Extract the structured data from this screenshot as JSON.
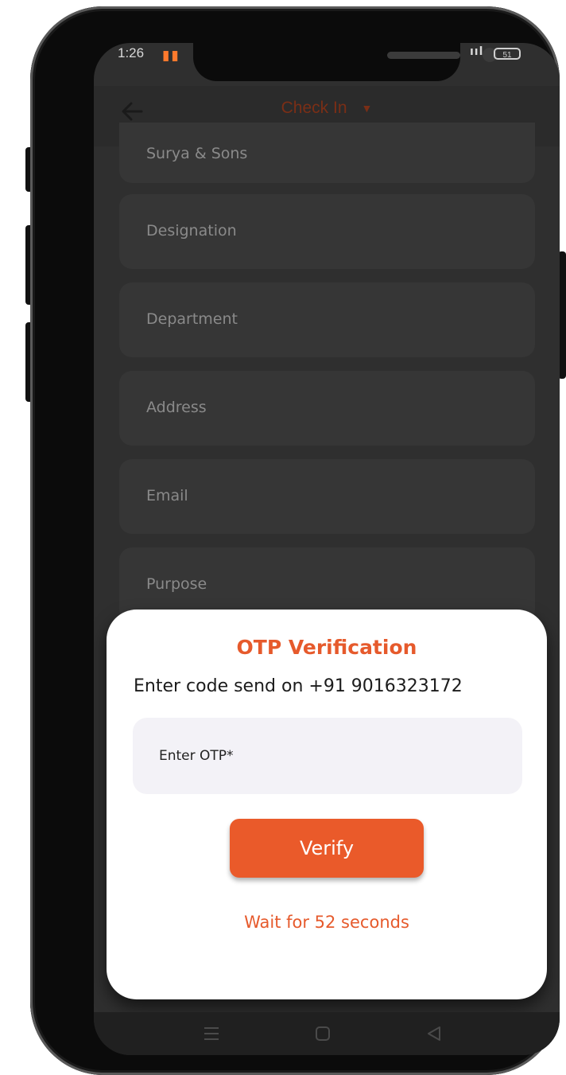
{
  "status_bar": {
    "time": "1:26",
    "notification_icon": "orange-bars-icon",
    "signal": "ııl",
    "battery": "51"
  },
  "header": {
    "title": "Check In",
    "back_icon": "arrow-left-icon",
    "dropdown_icon": "caret-down-icon"
  },
  "form": {
    "company_value": "Surya & Sons",
    "designation_label": "Designation",
    "department_label": "Department",
    "address_label": "Address",
    "email_label": "Email",
    "purpose_label": "Purpose"
  },
  "dialog": {
    "title": "OTP Verification",
    "subtitle": "Enter code send on +91 9016323172",
    "otp_placeholder": "Enter OTP*",
    "verify_label": "Verify",
    "wait_text": "Wait for 52 seconds"
  },
  "navbar": {
    "items": [
      "menu-icon",
      "home-square-icon",
      "back-triangle-icon"
    ]
  },
  "colors": {
    "accent": "#EA5A2A",
    "overlay_bg": "#2F2F2F",
    "dialog_bg": "#FFFFFF",
    "input_bg": "#F3F2F7"
  }
}
